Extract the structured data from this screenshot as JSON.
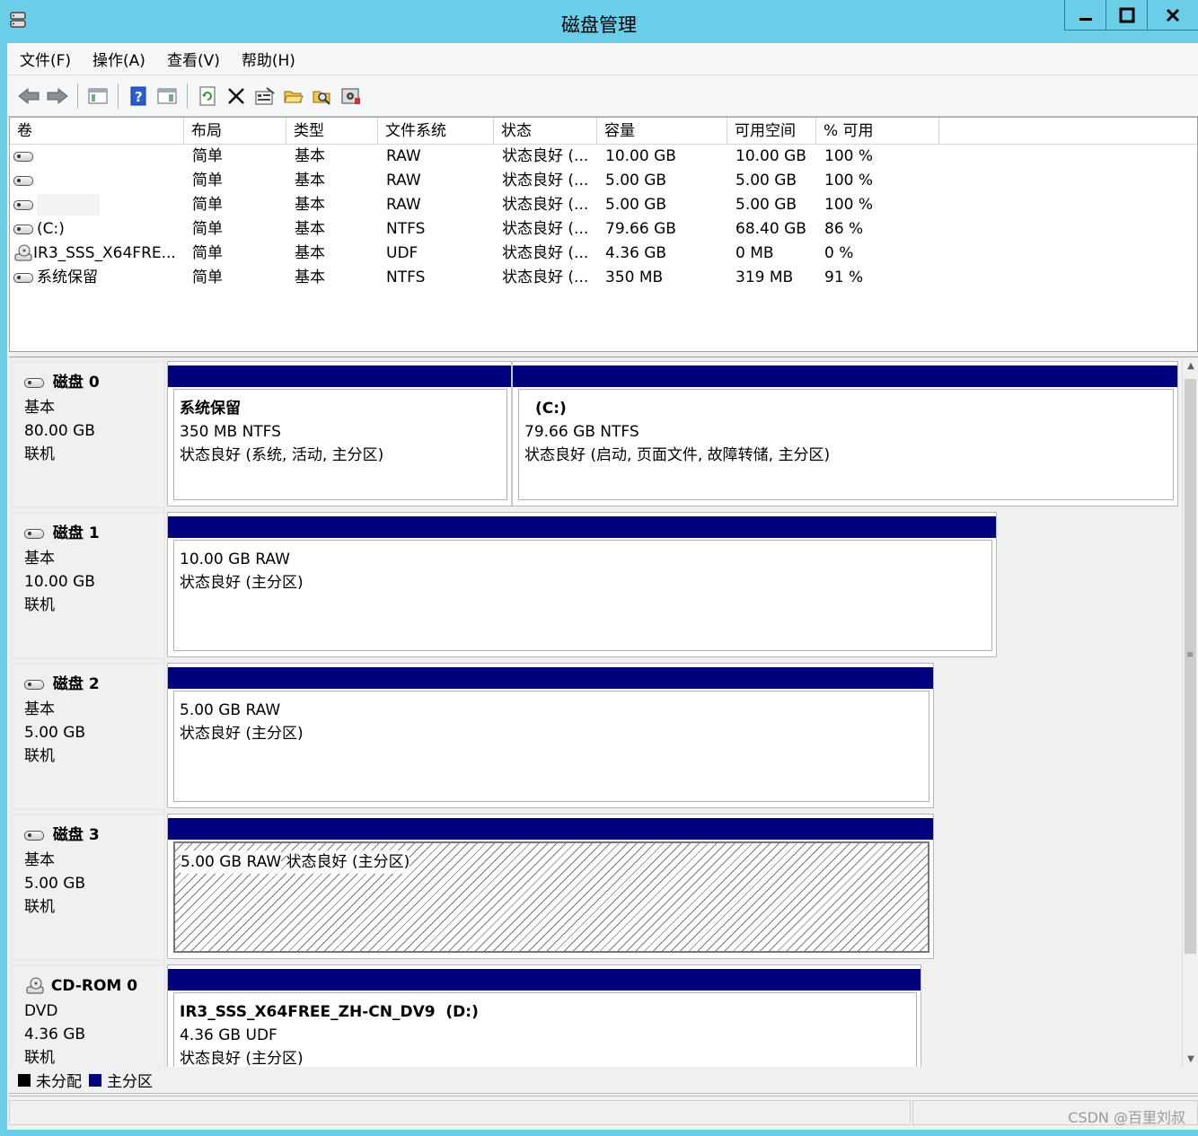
{
  "window": {
    "title": "磁盘管理"
  },
  "menu": [
    "文件(F)",
    "操作(A)",
    "查看(V)",
    "帮助(H)"
  ],
  "toolbar": [
    "back-icon",
    "forward-icon",
    "console-tree-icon",
    "help-icon",
    "action-pane-icon",
    "refresh-icon",
    "delete-icon",
    "properties-icon",
    "open-icon",
    "explore-icon",
    "settings-icon"
  ],
  "volume_list": {
    "headers": [
      "卷",
      "布局",
      "类型",
      "文件系统",
      "状态",
      "容量",
      "可用空间",
      "% 可用"
    ],
    "rows": [
      {
        "name": "",
        "layout": "简单",
        "type": "基本",
        "fs": "RAW",
        "status": "状态良好 (...",
        "capacity": "10.00 GB",
        "free": "10.00 GB",
        "pct": "100 %"
      },
      {
        "name": "",
        "layout": "简单",
        "type": "基本",
        "fs": "RAW",
        "status": "状态良好 (...",
        "capacity": "5.00 GB",
        "free": "5.00 GB",
        "pct": "100 %"
      },
      {
        "name": "",
        "layout": "简单",
        "type": "基本",
        "fs": "RAW",
        "status": "状态良好 (...",
        "capacity": "5.00 GB",
        "free": "5.00 GB",
        "pct": "100 %"
      },
      {
        "name": "(C:)",
        "layout": "简单",
        "type": "基本",
        "fs": "NTFS",
        "status": "状态良好 (...",
        "capacity": "79.66 GB",
        "free": "68.40 GB",
        "pct": "86 %"
      },
      {
        "name": "IR3_SSS_X64FRE...",
        "layout": "简单",
        "type": "基本",
        "fs": "UDF",
        "status": "状态良好 (...",
        "capacity": "4.36 GB",
        "free": "0 MB",
        "pct": "0 %"
      },
      {
        "name": "系统保留",
        "layout": "简单",
        "type": "基本",
        "fs": "NTFS",
        "status": "状态良好 (...",
        "capacity": "350 MB",
        "free": "319 MB",
        "pct": "91 %"
      }
    ]
  },
  "disks": [
    {
      "name": "磁盘 0",
      "kind": "基本",
      "size": "80.00 GB",
      "state": "联机",
      "partitions": [
        {
          "name": "系统保留",
          "size": "350 MB NTFS",
          "status": "状态良好 (系统, 活动, 主分区)"
        },
        {
          "name": "(C:)",
          "size": "79.66 GB NTFS",
          "status": "状态良好 (启动, 页面文件, 故障转储, 主分区)"
        }
      ]
    },
    {
      "name": "磁盘 1",
      "kind": "基本",
      "size": "10.00 GB",
      "state": "联机",
      "partitions": [
        {
          "name": "",
          "size": "10.00 GB RAW",
          "status": "状态良好 (主分区)"
        }
      ]
    },
    {
      "name": "磁盘 2",
      "kind": "基本",
      "size": "5.00 GB",
      "state": "联机",
      "partitions": [
        {
          "name": "",
          "size": "5.00 GB RAW",
          "status": "状态良好 (主分区)"
        }
      ]
    },
    {
      "name": "磁盘 3",
      "kind": "基本",
      "size": "5.00 GB",
      "state": "联机",
      "partitions": [
        {
          "name": "",
          "size": "5.00 GB RAW",
          "status": "状态良好 (主分区)"
        }
      ]
    },
    {
      "name": "CD-ROM 0",
      "kind": "DVD",
      "size": "4.36 GB",
      "state": "联机",
      "partitions": [
        {
          "name": "IR3_SSS_X64FREE_ZH-CN_DV9  (D:)",
          "size": "4.36 GB UDF",
          "status": "状态良好 (主分区)"
        }
      ]
    }
  ],
  "legend": [
    {
      "label": "未分配",
      "color": "#000000"
    },
    {
      "label": "主分区",
      "color": "#00007f"
    }
  ],
  "watermark": "CSDN @百里刘叔"
}
